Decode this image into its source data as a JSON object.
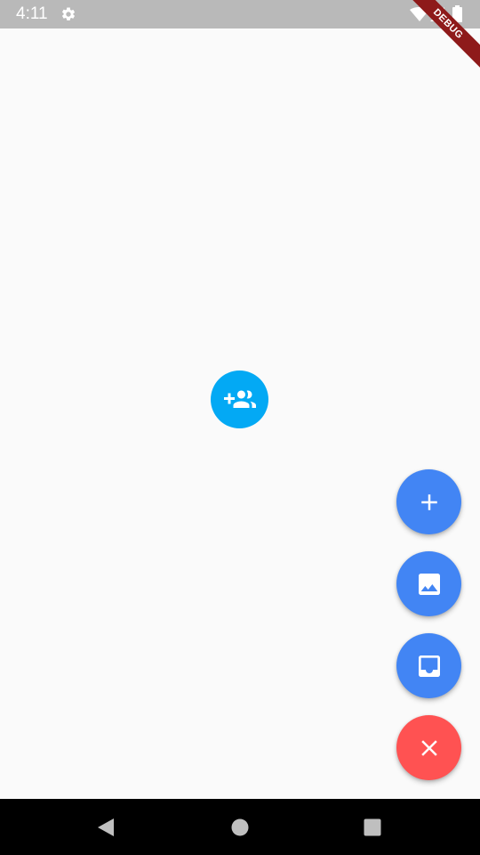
{
  "status_bar": {
    "time": "4:11",
    "icons": [
      "gear-icon",
      "wifi-icon",
      "signal-icon",
      "battery-icon"
    ]
  },
  "debug_banner": {
    "label": "DEBUG"
  },
  "center_button": {
    "icon": "group-add-icon",
    "color": "#03a9f4"
  },
  "fabs": [
    {
      "icon": "add-icon",
      "color": "#4285f4"
    },
    {
      "icon": "image-icon",
      "color": "#4285f4"
    },
    {
      "icon": "inbox-icon",
      "color": "#4285f4"
    },
    {
      "icon": "close-icon",
      "color": "#ff5252"
    }
  ],
  "nav_bar": {
    "icons": [
      "back-icon",
      "home-icon",
      "recents-icon"
    ]
  }
}
